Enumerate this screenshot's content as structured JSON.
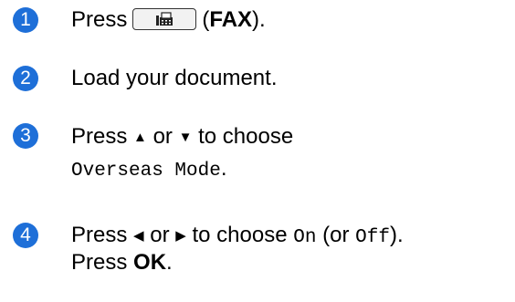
{
  "steps": [
    {
      "num": "1",
      "press": "Press",
      "paren_open": "(",
      "key": "FAX",
      "paren_close": ")."
    },
    {
      "num": "2",
      "text": "Load your document."
    },
    {
      "num": "3",
      "press": "Press",
      "up": "▲",
      "or": "or",
      "down": "▼",
      "to_choose": "to choose",
      "menu": "Overseas Mode",
      "period": "."
    },
    {
      "num": "4",
      "press": "Press",
      "left": "◀",
      "or": "or",
      "right": "▶",
      "to_choose": "to choose",
      "on": "On",
      "paren_or": "(or",
      "off": "Off",
      "close": ").",
      "press2": "Press",
      "ok": "OK",
      "period": "."
    }
  ],
  "icons": {
    "fax_button": "fax-icon"
  },
  "colors": {
    "badge": "#1e6fd8"
  }
}
